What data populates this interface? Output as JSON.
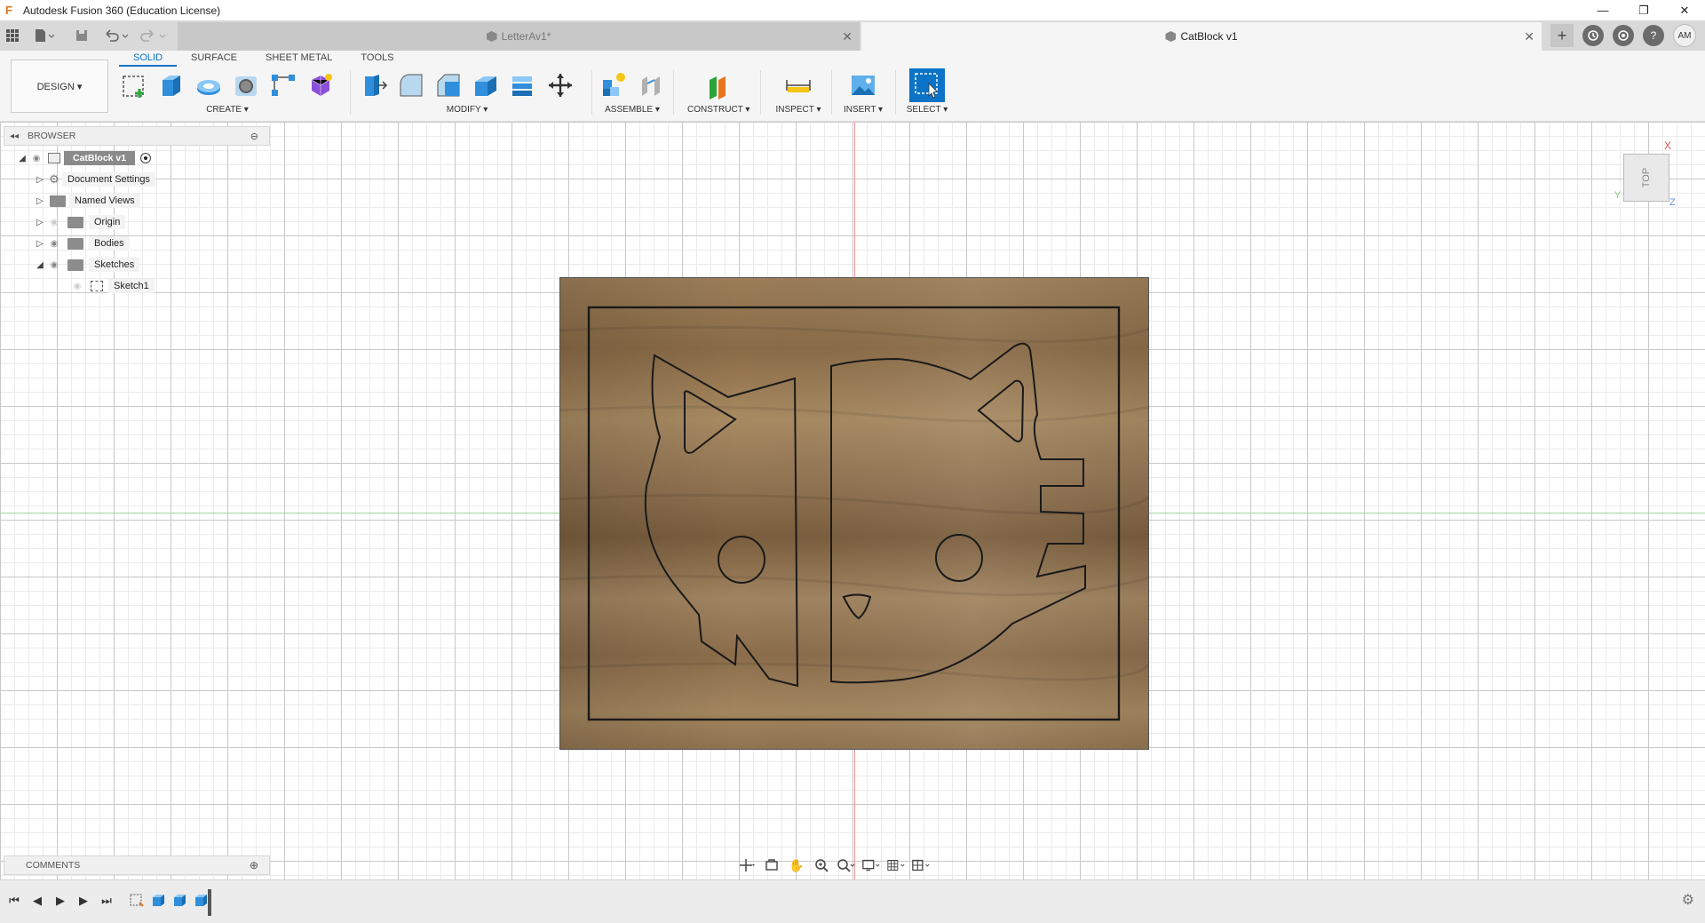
{
  "window": {
    "app_icon": "F",
    "title": "Autodesk Fusion 360 (Education License)",
    "controls": {
      "minimize": "—",
      "restore": "❐",
      "close": "✕"
    }
  },
  "tabs": [
    {
      "label": "LetterAv1*",
      "active": false
    },
    {
      "label": "CatBlock v1",
      "active": true
    }
  ],
  "tab_close": "✕",
  "header_right": {
    "plus": "+",
    "avatar": "AM",
    "help": "?"
  },
  "design_button": {
    "label": "DESIGN ▾"
  },
  "workspace_tabs": [
    "SOLID",
    "SURFACE",
    "SHEET METAL",
    "TOOLS"
  ],
  "tool_groups": {
    "create": "CREATE ▾",
    "modify": "MODIFY ▾",
    "assemble": "ASSEMBLE ▾",
    "construct": "CONSTRUCT ▾",
    "inspect": "INSPECT ▾",
    "insert": "INSERT ▾",
    "select": "SELECT ▾"
  },
  "browser": {
    "header": "BROWSER",
    "collapse_symbol": "◂◂",
    "header_action": "⊖",
    "root": "CatBlock v1",
    "items": [
      "Document Settings",
      "Named Views",
      "Origin",
      "Bodies",
      "Sketches"
    ],
    "sketch": "Sketch1"
  },
  "comments": {
    "label": "COMMENTS",
    "action": "⊕"
  },
  "viewcube": {
    "face": "TOP",
    "x": "X",
    "y": "Y",
    "z": "Z"
  },
  "colors": {
    "accent": "#0c73c6",
    "wood": "#8f7350",
    "axis_red": "#f19a9a",
    "axis_green": "#9ed89e"
  }
}
